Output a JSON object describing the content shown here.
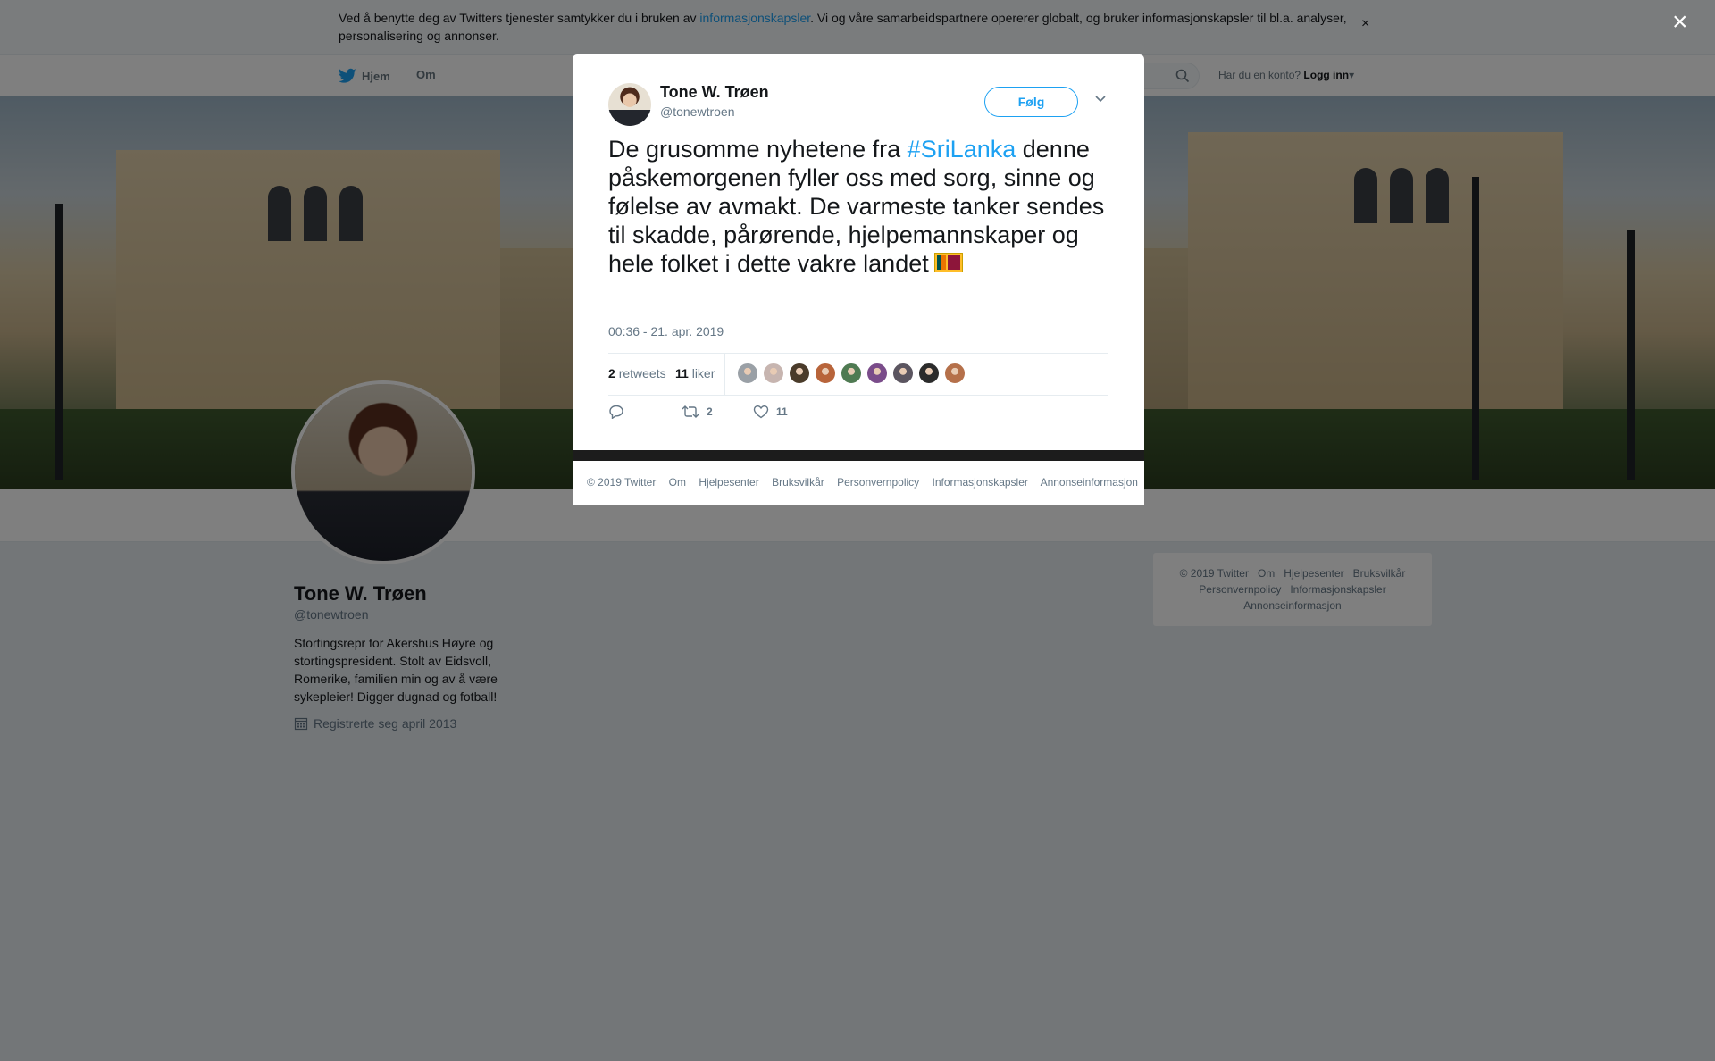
{
  "cookie_banner": {
    "text_before": "Ved å benytte deg av Twitters tjenester samtykker du i bruken av ",
    "link": "informasjonskapsler",
    "text_after": ". Vi og våre samarbeidspartnere opererer globalt, og bruker informasjonskapsler til bl.a. analyser, personalisering og annonser.",
    "close_label": "×"
  },
  "nav": {
    "home": "Hjem",
    "about": "Om",
    "account_prompt": "Har du en konto?",
    "login": "Logg inn"
  },
  "profile": {
    "name": "Tone W. Trøen",
    "handle": "@tonewtroen",
    "bio": "Stortingsrepr for Akershus Høyre og stortingspresident. Stolt av Eidsvoll, Romerike, familien min og av å være sykepleier! Digger dugnad og fotball!",
    "joined": "Registrerte seg april 2013"
  },
  "footer_links": [
    "© 2019 Twitter",
    "Om",
    "Hjelpesenter",
    "Bruksvilkår",
    "Personvernpolicy",
    "Informasjonskapsler",
    "Annonseinformasjon"
  ],
  "modal": {
    "close_label": "×",
    "tweet": {
      "author_name": "Tone W. Trøen",
      "author_handle": "@tonewtroen",
      "follow_label": "Følg",
      "text_before": "De grusomme nyhetene fra ",
      "hashtag": "#SriLanka",
      "text_after": " denne påskemorgenen fyller oss med sorg, sinne og følelse av avmakt. De varmeste tanker sendes til skadde, pårørende, hjelpemannskaper og hele folket i dette vakre landet",
      "timestamp": "00:36 - 21. apr. 2019",
      "retweets_count": "2",
      "retweets_label": "retweets",
      "likes_count": "11",
      "likes_label": "liker",
      "retweet_action_count": "2",
      "like_action_count": "11"
    },
    "liker_avatar_colors": [
      "#9aa0a6",
      "#c7b5b0",
      "#4a3b2a",
      "#b8643a",
      "#4f7a52",
      "#7a4c8a",
      "#5b5560",
      "#2b2b2b",
      "#b5704a"
    ]
  },
  "colors": {
    "brand_blue": "#1da1f2",
    "text_primary": "#14171a",
    "text_secondary": "#657786"
  }
}
